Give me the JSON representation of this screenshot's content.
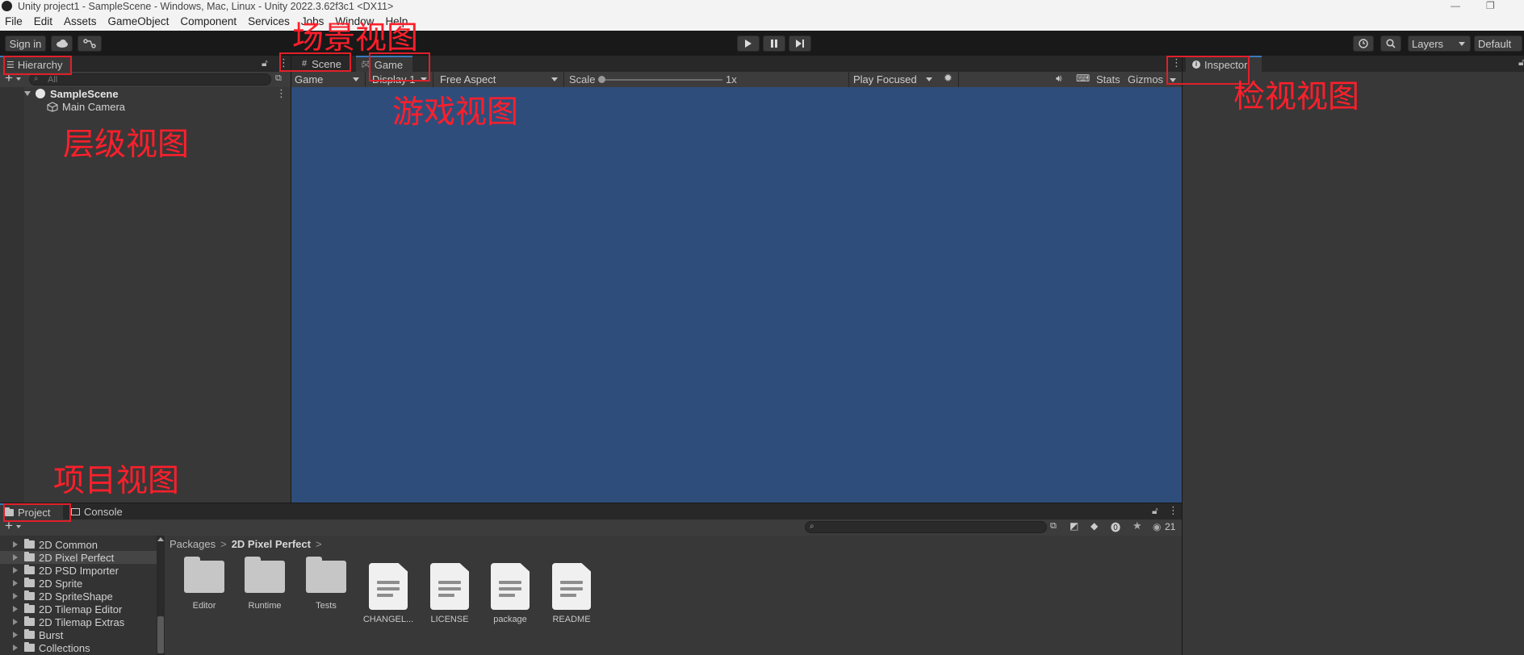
{
  "window": {
    "title": "Unity project1 - SampleScene - Windows, Mac, Linux - Unity 2022.3.62f3c1 <DX11>",
    "min": "—",
    "max": "❐"
  },
  "menu": [
    "File",
    "Edit",
    "Assets",
    "GameObject",
    "Component",
    "Services",
    "Jobs",
    "Window",
    "Help"
  ],
  "toolbar": {
    "sign_in": "Sign in",
    "layers": "Layers",
    "layout": "Default"
  },
  "hierarchy": {
    "tab": "Hierarchy",
    "search_placeholder": "All",
    "scene": "SampleScene",
    "items": [
      "Main Camera"
    ]
  },
  "center_tabs": {
    "scene": "Scene",
    "game": "Game"
  },
  "game_toolbar": {
    "mode": "Game",
    "display": "Display 1",
    "aspect": "Free Aspect",
    "scale_label": "Scale",
    "scale_value": "1x",
    "play_mode": "Play Focused",
    "stats": "Stats",
    "gizmos": "Gizmos"
  },
  "inspector": {
    "tab": "Inspector"
  },
  "bottom_tabs": {
    "project": "Project",
    "console": "Console"
  },
  "project": {
    "folders": [
      "2D Common",
      "2D Pixel Perfect",
      "2D PSD Importer",
      "2D Sprite",
      "2D SpriteShape",
      "2D Tilemap Editor",
      "2D Tilemap Extras",
      "Burst",
      "Collections"
    ],
    "breadcrumb": [
      "Packages",
      "2D Pixel Perfect"
    ],
    "assets": [
      {
        "name": "Editor",
        "kind": "folder"
      },
      {
        "name": "Runtime",
        "kind": "folder"
      },
      {
        "name": "Tests",
        "kind": "folder"
      },
      {
        "name": "CHANGEL...",
        "kind": "doc"
      },
      {
        "name": "LICENSE",
        "kind": "doc"
      },
      {
        "name": "package",
        "kind": "doc"
      },
      {
        "name": "README",
        "kind": "doc"
      }
    ],
    "hidden_count": "21"
  },
  "annotations": {
    "scene": "场景视图",
    "game": "游戏视图",
    "hierarchy": "层级视图",
    "inspector": "检视视图",
    "project": "项目视图"
  },
  "colors": {
    "game_view": "#2f4d7b",
    "annotation": "#ff1f2b",
    "tab_accent": "#3a79bb"
  }
}
